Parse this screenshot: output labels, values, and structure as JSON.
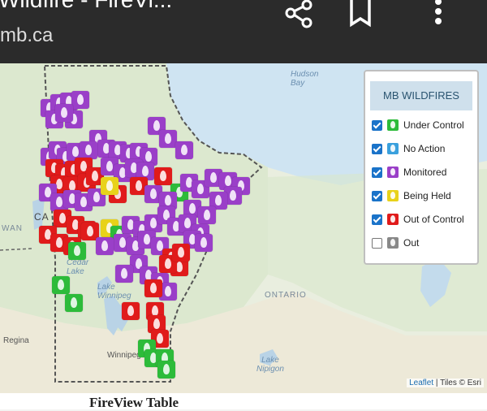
{
  "browser": {
    "title": "Wildfire - FireVi...",
    "url": "mb.ca",
    "icons": [
      "share-icon",
      "bookmark-icon",
      "more-vert-icon"
    ]
  },
  "map": {
    "labels": {
      "hudson_bay": "Hudson\nBay",
      "ontario": "ONTARIO",
      "regina": "Regina",
      "winnipeg": "Winnipeg",
      "lake_nipigon": "Lake\nNipigon",
      "cedar_lake": "Cedar\nLake",
      "lake_winnipeg": "Lake\nWinnipeg",
      "wan": "WAN",
      "canada_partial": "CA"
    },
    "attribution": {
      "link": "Leaflet",
      "text": " | Tiles © Esri"
    },
    "colors": {
      "under_control": "#2dbb3a",
      "no_action": "#3aa0dd",
      "monitored": "#9a3fc8",
      "being_held": "#e8d21a",
      "out_of_control": "#e01b1b",
      "out": "#888888"
    }
  },
  "legend": {
    "title": "MB WILDFIRES",
    "items": [
      {
        "label": "Under Control",
        "checked": true,
        "color": "#2dbb3a"
      },
      {
        "label": "No Action",
        "checked": true,
        "color": "#3aa0dd"
      },
      {
        "label": "Monitored",
        "checked": true,
        "color": "#9a3fc8"
      },
      {
        "label": "Being Held",
        "checked": true,
        "color": "#e8d21a"
      },
      {
        "label": "Out of Control",
        "checked": true,
        "color": "#e01b1b"
      },
      {
        "label": "Out",
        "checked": false,
        "color": "#888888"
      }
    ]
  },
  "bottom": {
    "table_title": "FireView Table"
  }
}
